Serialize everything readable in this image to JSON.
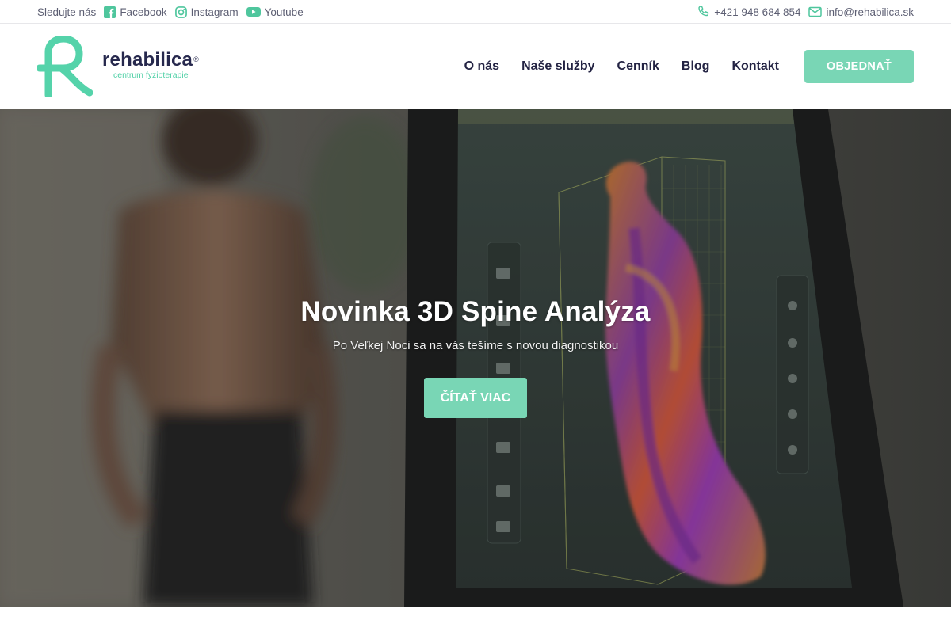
{
  "topbar": {
    "follow_label": "Sledujte nás",
    "social": [
      {
        "label": "Facebook",
        "icon": "facebook-icon"
      },
      {
        "label": "Instagram",
        "icon": "instagram-icon"
      },
      {
        "label": "Youtube",
        "icon": "youtube-icon"
      }
    ],
    "phone": "+421 948 684 854",
    "email": "info@rehabilica.sk"
  },
  "brand": {
    "name": "rehabilica",
    "registered": "®",
    "tagline": "centrum fyzioterapie",
    "accent_color": "#79d6b5",
    "text_color": "#26284d"
  },
  "nav": {
    "items": [
      "O nás",
      "Naše služby",
      "Cenník",
      "Blog",
      "Kontakt"
    ],
    "order_button": "OBJEDNAŤ"
  },
  "hero": {
    "title": "Novinka 3D Spine Analýza",
    "subtitle": "Po Veľkej Noci sa na vás tešíme s novou diagnostikou",
    "button": "ČÍTAŤ VIAC"
  }
}
